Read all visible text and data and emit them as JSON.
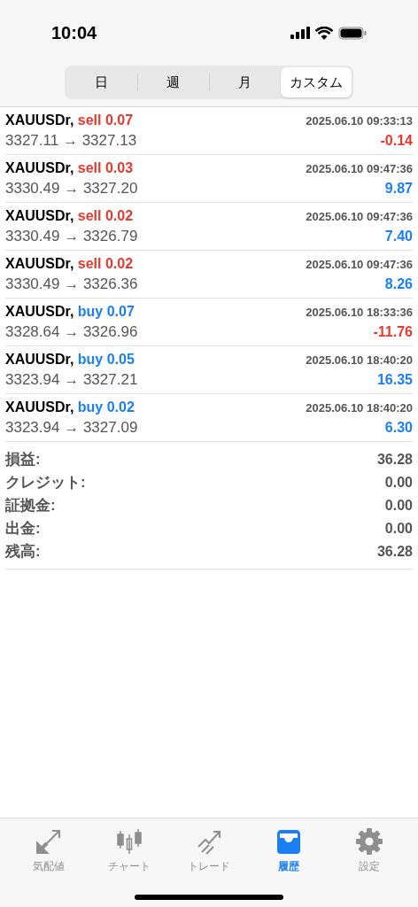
{
  "status_bar": {
    "time": "10:04"
  },
  "period_tabs": [
    {
      "label": "日",
      "selected": false
    },
    {
      "label": "週",
      "selected": false
    },
    {
      "label": "月",
      "selected": false
    },
    {
      "label": "カスタム",
      "selected": true
    }
  ],
  "trades": [
    {
      "symbol": "XAUUSDr,",
      "order": {
        "kind": "sell",
        "text": "sell 0.07"
      },
      "time": "2025.06.10 09:33:13",
      "prices": "3327.11 → 3327.13",
      "profit": {
        "kind": "loss",
        "text": "-0.14"
      }
    },
    {
      "symbol": "XAUUSDr,",
      "order": {
        "kind": "sell",
        "text": "sell 0.03"
      },
      "time": "2025.06.10 09:47:36",
      "prices": "3330.49 → 3327.20",
      "profit": {
        "kind": "gain",
        "text": "9.87"
      }
    },
    {
      "symbol": "XAUUSDr,",
      "order": {
        "kind": "sell",
        "text": "sell 0.02"
      },
      "time": "2025.06.10 09:47:36",
      "prices": "3330.49 → 3326.79",
      "profit": {
        "kind": "gain",
        "text": "7.40"
      }
    },
    {
      "symbol": "XAUUSDr,",
      "order": {
        "kind": "sell",
        "text": "sell 0.02"
      },
      "time": "2025.06.10 09:47:36",
      "prices": "3330.49 → 3326.36",
      "profit": {
        "kind": "gain",
        "text": "8.26"
      }
    },
    {
      "symbol": "XAUUSDr,",
      "order": {
        "kind": "buy",
        "text": "buy 0.07"
      },
      "time": "2025.06.10 18:33:36",
      "prices": "3328.64 → 3326.96",
      "profit": {
        "kind": "loss",
        "text": "-11.76"
      }
    },
    {
      "symbol": "XAUUSDr,",
      "order": {
        "kind": "buy",
        "text": "buy 0.05"
      },
      "time": "2025.06.10 18:40:20",
      "prices": "3323.94 → 3327.21",
      "profit": {
        "kind": "gain",
        "text": "16.35"
      }
    },
    {
      "symbol": "XAUUSDr,",
      "order": {
        "kind": "buy",
        "text": "buy 0.02"
      },
      "time": "2025.06.10 18:40:20",
      "prices": "3323.94 → 3327.09",
      "profit": {
        "kind": "gain",
        "text": "6.30"
      }
    }
  ],
  "summary": [
    {
      "label": "損益:",
      "value": "36.28"
    },
    {
      "label": "クレジット:",
      "value": "0.00"
    },
    {
      "label": "証拠金:",
      "value": "0.00"
    },
    {
      "label": "出金:",
      "value": "0.00"
    },
    {
      "label": "残高:",
      "value": "36.28"
    }
  ],
  "tab_bar": [
    {
      "label": "気配値",
      "kind": "quotes",
      "selected": false
    },
    {
      "label": "チャート",
      "kind": "chart",
      "selected": false
    },
    {
      "label": "トレード",
      "kind": "trade",
      "selected": false
    },
    {
      "label": "履歴",
      "kind": "history",
      "selected": true
    },
    {
      "label": "設定",
      "kind": "settings",
      "selected": false
    }
  ]
}
